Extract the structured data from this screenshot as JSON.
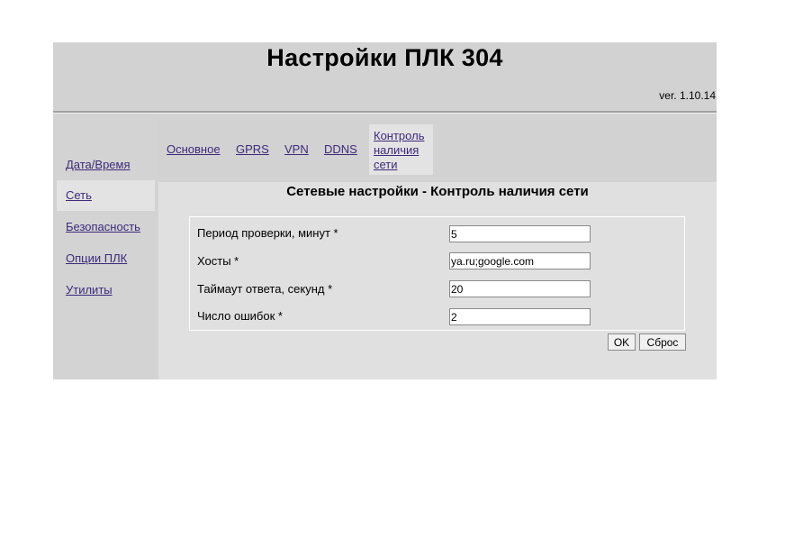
{
  "header": {
    "title": "Настройки ПЛК 304",
    "version": "ver. 1.10.14"
  },
  "sidebar": {
    "items": [
      {
        "label": "Дата/Время",
        "active": false
      },
      {
        "label": "Сеть",
        "active": true
      },
      {
        "label": "Безопасность",
        "active": false
      },
      {
        "label": "Опции ПЛК",
        "active": false
      },
      {
        "label": "Утилиты",
        "active": false
      }
    ]
  },
  "tabs": [
    {
      "label": "Основное",
      "active": false
    },
    {
      "label": "GPRS",
      "active": false
    },
    {
      "label": "VPN",
      "active": false
    },
    {
      "label": "DDNS",
      "active": false
    },
    {
      "label": "Контроль наличия сети",
      "active": true
    }
  ],
  "section": {
    "title": "Сетевые настройки - Контроль наличия сети"
  },
  "form": {
    "fields": [
      {
        "label": "Период проверки, минут *",
        "value": "5"
      },
      {
        "label": "Хосты *",
        "value": "ya.ru;google.com"
      },
      {
        "label": "Таймаут ответа, секунд *",
        "value": "20"
      },
      {
        "label": "Число ошибок *",
        "value": "2"
      }
    ],
    "ok_label": "OK",
    "reset_label": "Сброс"
  },
  "colors": {
    "link": "#3e2a7a",
    "frame_bg": "#d3d3d3",
    "content_bg": "#e0e0e0"
  }
}
